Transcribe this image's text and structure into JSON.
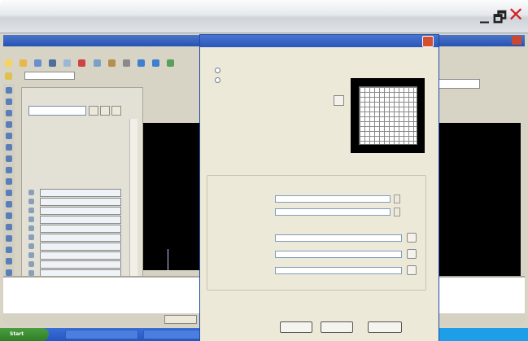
{
  "viewer": {
    "minimize_glyph": "_",
    "restore_glyph": "🗗",
    "close_glyph": "✕",
    "close_color": "#d12222"
  },
  "taskbar": {
    "start_label": "Start"
  }
}
